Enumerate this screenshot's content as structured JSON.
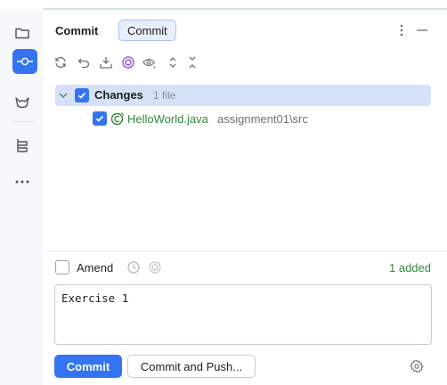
{
  "header": {
    "title": "Commit",
    "tab_label": "Commit",
    "more_icon": "more-vertical-icon",
    "minimize_icon": "minimize-icon"
  },
  "sidebar": {
    "items": [
      {
        "icon": "folder-icon",
        "active": false
      },
      {
        "icon": "commit-icon",
        "active": true
      },
      {
        "icon": "merge-request-icon",
        "active": false
      },
      {
        "icon": "structure-icon",
        "active": false
      },
      {
        "icon": "more-horizontal-icon",
        "active": false
      }
    ]
  },
  "toolbar": {
    "icons": [
      "refresh-icon",
      "rollback-icon",
      "shelve-icon",
      "ai-assistant-icon",
      "preview-diff-icon",
      "expand-all-icon",
      "collapse-all-icon"
    ]
  },
  "tree": {
    "changes_label": "Changes",
    "changes_count": "1 file",
    "files": [
      {
        "name": "HelloWorld.java",
        "path": "assignment01\\src",
        "icon": "java-class-icon"
      }
    ]
  },
  "amend": {
    "label": "Amend",
    "added": "1 added"
  },
  "message": {
    "value": "Exercise 1"
  },
  "actions": {
    "commit_label": "Commit",
    "commit_push_label": "Commit and Push...",
    "settings_icon": "settings-icon"
  },
  "colors": {
    "accent": "#3574f0",
    "selection": "#d5e1f8",
    "added": "#2f8a3c"
  }
}
